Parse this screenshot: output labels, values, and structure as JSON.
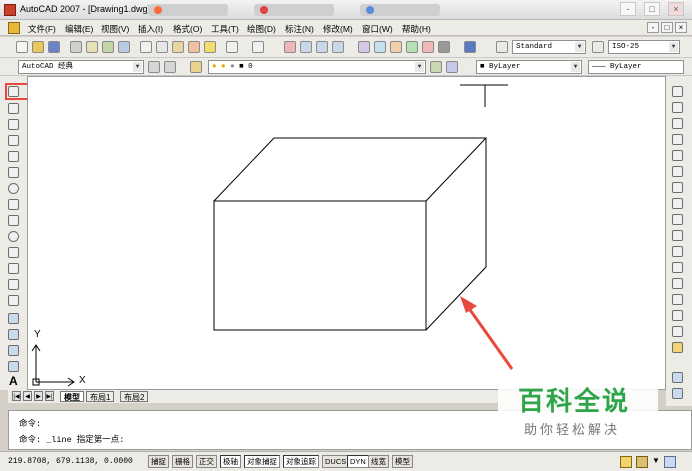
{
  "window": {
    "title": "AutoCAD 2007 - [Drawing1.dwg]",
    "controls": [
      "-",
      "□",
      "×"
    ]
  },
  "menubar": {
    "items": [
      "文件(F)",
      "编辑(E)",
      "视图(V)",
      "插入(I)",
      "格式(O)",
      "工具(T)",
      "绘图(D)",
      "标注(N)",
      "修改(M)",
      "窗口(W)",
      "帮助(H)"
    ],
    "doc_controls": [
      "-",
      "□",
      "×"
    ]
  },
  "toolbar1": {
    "text_style": "Standard",
    "dim_style": "ISO-25"
  },
  "toolbar2": {
    "workspace": "AutoCAD 经典",
    "layer": "0",
    "color": "ByLayer",
    "linetype": "ByLayer"
  },
  "canvas": {
    "ucs_x": "X",
    "ucs_y": "Y"
  },
  "layout_tabs": [
    "模型",
    "布局1",
    "布局2"
  ],
  "command": {
    "line1": "命令:",
    "line2": "命令: _line 指定第一点:"
  },
  "statusbar": {
    "coords": "219.8708, 679.1138, 0.0000",
    "buttons": [
      "捕捉",
      "栅格",
      "正交",
      "极轴",
      "对象捕捉",
      "对象追踪",
      "DUCS",
      "DYN",
      "线宽",
      "模型"
    ]
  },
  "watermark": {
    "main": "百科全说",
    "sub": "助你轻松解决"
  },
  "colors": {
    "accent_red": "#e8493c",
    "watermark_green": "#2fa54a"
  }
}
